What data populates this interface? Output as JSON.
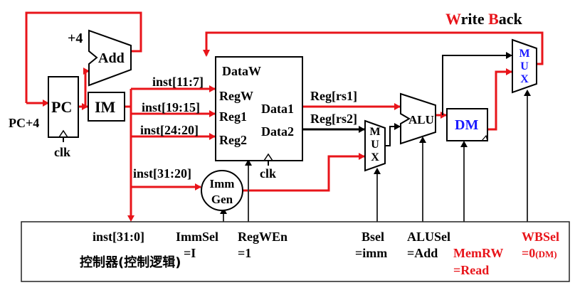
{
  "title": {
    "w_letter": "W",
    "w_rest": "rite ",
    "b_letter": "B",
    "b_rest": "ack"
  },
  "plus4": "+4",
  "add_label": "Add",
  "pc_label": "PC",
  "pc_plus4": "PC+4",
  "pc_clk": "clk",
  "im_label": "IM",
  "regfile": {
    "dataw": "DataW",
    "regw": "RegW",
    "reg1": "Reg1",
    "reg2": "Reg2",
    "data1": "Data1",
    "data2": "Data2",
    "clk": "clk"
  },
  "inst_fields": {
    "f11_7": "inst[11:7]",
    "f19_15": "inst[19:15]",
    "f24_20": "inst[24:20]",
    "f31_20": "inst[31:20]"
  },
  "bus_labels": {
    "rs1": "Reg[rs1]",
    "rs2": "Reg[rs2]"
  },
  "mux_letters": [
    "M",
    "U",
    "X"
  ],
  "alu_label": "ALU",
  "dm_label": "DM",
  "immgen": {
    "line1": "Imm",
    "line2": "Gen"
  },
  "controller": {
    "inst": "inst[31:0]",
    "name": "控制器(控制逻辑)",
    "immsel": "ImmSel",
    "immsel_val": "=I",
    "regwen": "RegWEn",
    "regwen_val": "=1",
    "bsel": "Bsel",
    "bsel_val": "=imm",
    "alusel": "ALUSel",
    "alusel_val": "=Add",
    "memrw": "MemRW",
    "memrw_val": "=Read",
    "wbsel": "WBSel",
    "wbsel_val": "=0",
    "wbsel_suffix": "(DM)"
  },
  "colors": {
    "active": "#e8141a",
    "blue": "#1a1aff",
    "black": "#000000",
    "gray": "#444444"
  }
}
